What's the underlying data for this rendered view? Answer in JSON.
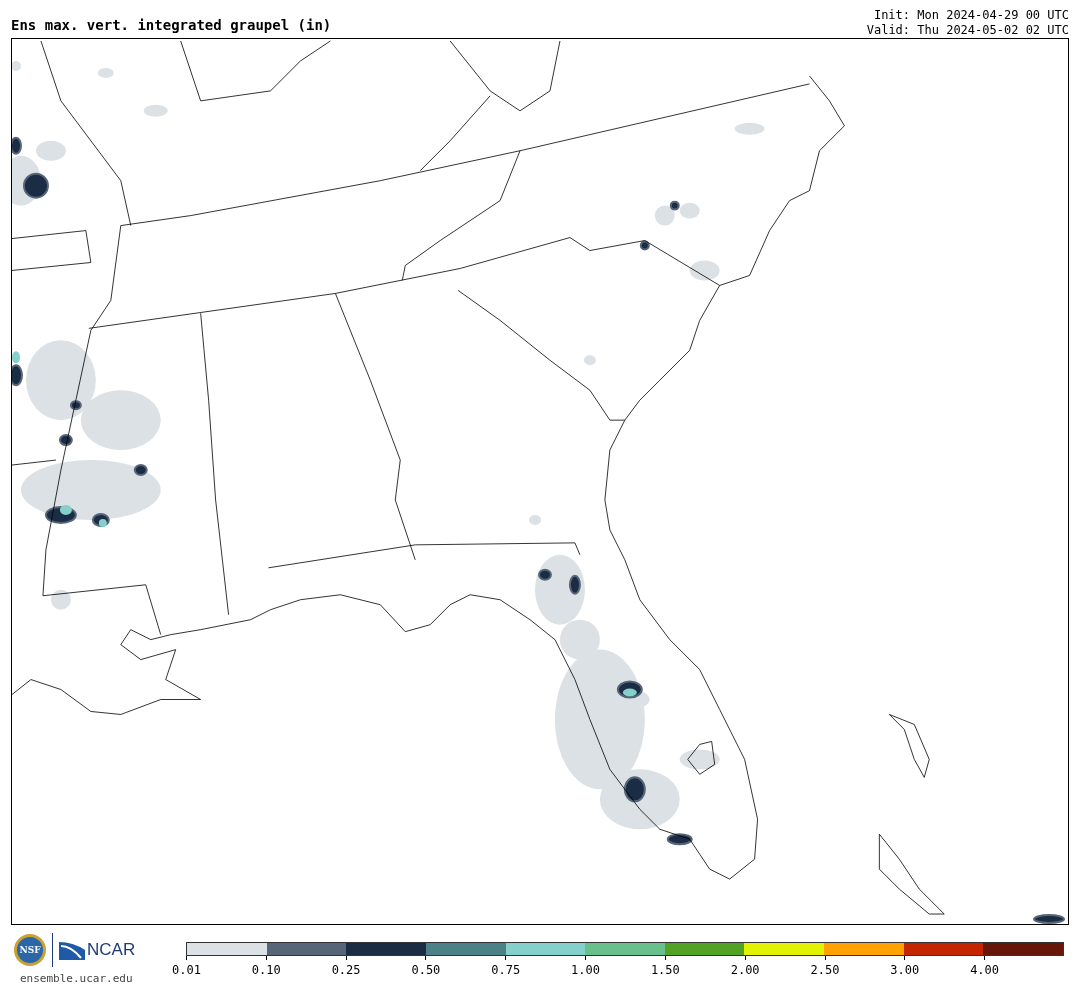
{
  "title": "Ens max. vert. integrated graupel (in)",
  "init": "Init: Mon 2024-04-29 00 UTC",
  "valid": "Valid: Thu 2024-05-02 02 UTC",
  "logos": {
    "nsf": "NSF",
    "ncar": "NCAR",
    "url": "ensemble.ucar.edu"
  },
  "colorbar": [
    {
      "label": "0.01",
      "color": "#dce1e5"
    },
    {
      "label": "0.10",
      "color": "#566578"
    },
    {
      "label": "0.25",
      "color": "#1b2d45"
    },
    {
      "label": "0.50",
      "color": "#4c8187"
    },
    {
      "label": "0.75",
      "color": "#85d0cb"
    },
    {
      "label": "1.00",
      "color": "#6ac08a"
    },
    {
      "label": "1.50",
      "color": "#52a325"
    },
    {
      "label": "2.00",
      "color": "#e2f200"
    },
    {
      "label": "2.50",
      "color": "#ffa200"
    },
    {
      "label": "3.00",
      "color": "#c42700"
    },
    {
      "label": "4.00",
      "color": "#66170a"
    }
  ]
}
